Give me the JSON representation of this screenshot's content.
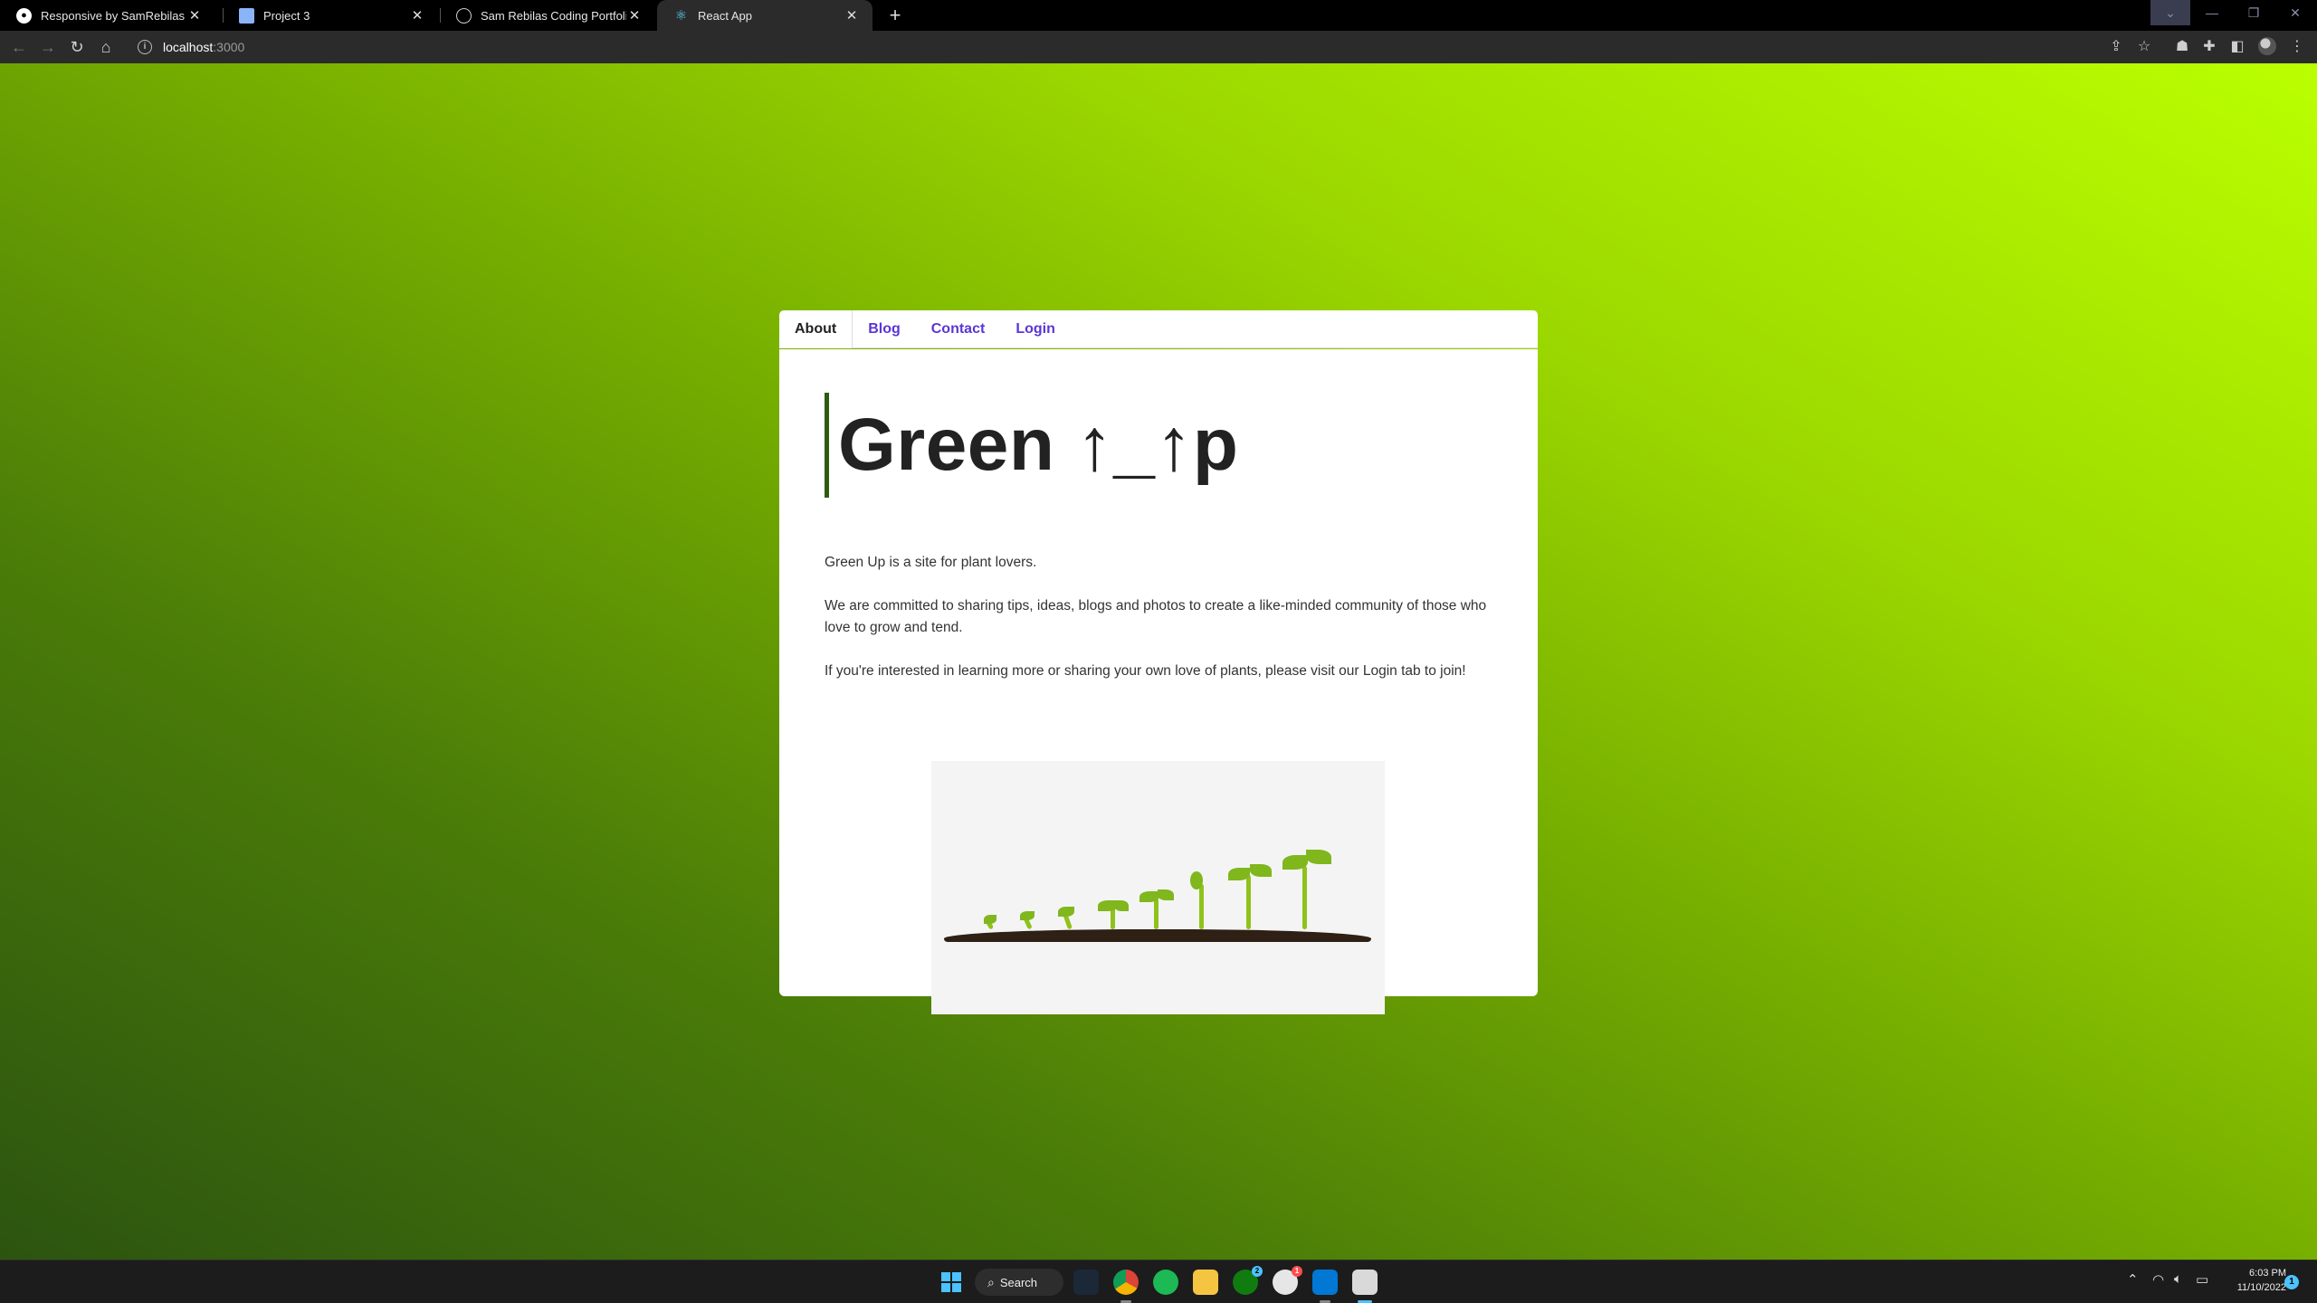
{
  "browser": {
    "tabs": [
      {
        "title": "Responsive by SamRebilas · Pull Re",
        "icon": "github-icon",
        "active": false
      },
      {
        "title": "Project 3",
        "icon": "document-icon",
        "active": false
      },
      {
        "title": "Sam Rebilas Coding Portfolio",
        "icon": "globe-icon",
        "active": false
      },
      {
        "title": "React App",
        "icon": "react-icon",
        "active": true
      }
    ],
    "new_tab_label": "+",
    "close_glyph": "✕",
    "url_host": "localhost",
    "url_port": ":3000"
  },
  "site": {
    "nav": [
      "About",
      "Blog",
      "Contact",
      "Login"
    ],
    "active_nav": "About",
    "heading": "Green ↑_↑p",
    "paragraphs": [
      "Green Up is a site for plant lovers.",
      "We are committed to sharing tips, ideas, blogs and photos to create a like-minded community of those who love to grow and tend.",
      "If you're interested in learning more or sharing your own love of plants, please visit our Login tab to join!"
    ],
    "image_alt": "seedlings sprouting from soil",
    "accent_color": "#5b35d5",
    "heading_bar_color": "#2d5c10"
  },
  "taskbar": {
    "search_label": "Search",
    "time": "6:03 PM",
    "date": "11/10/2022",
    "notification_count": "1",
    "xbox_badge": "2",
    "app_badge": "1"
  }
}
